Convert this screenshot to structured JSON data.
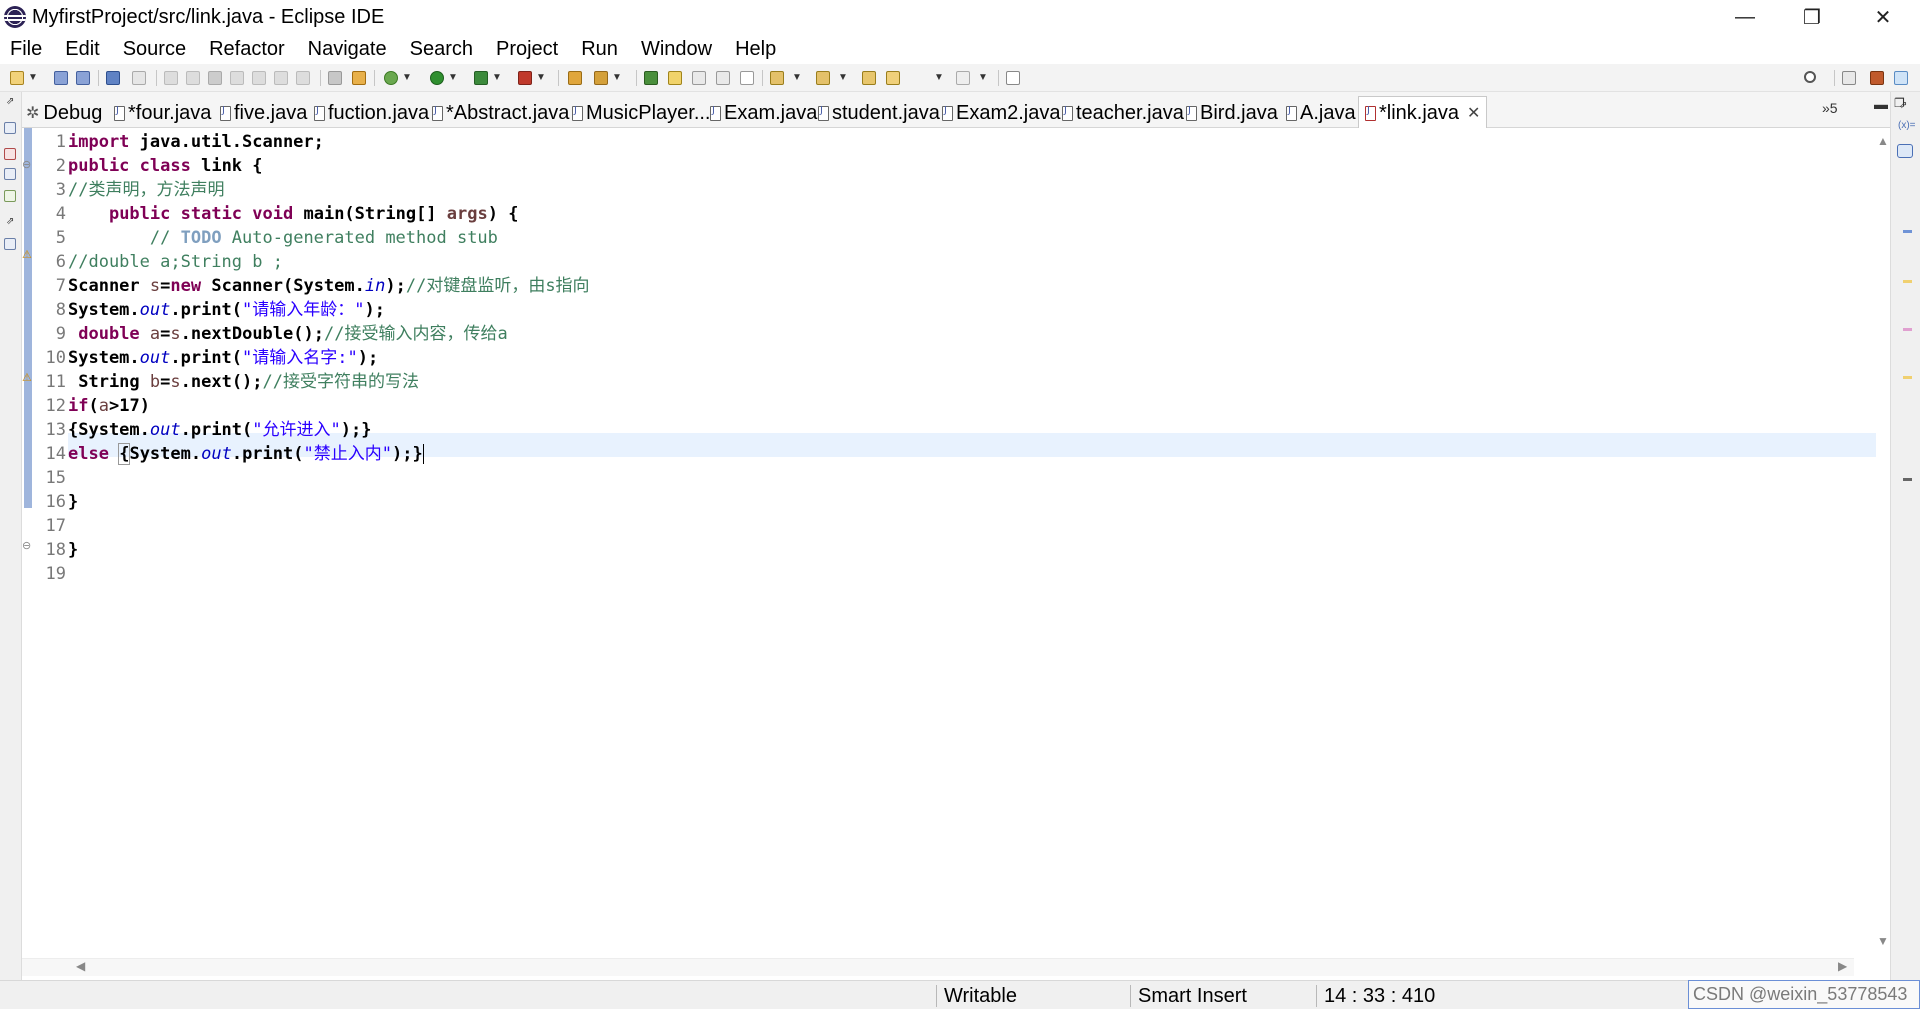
{
  "window": {
    "title": "MyfirstProject/src/link.java - Eclipse IDE",
    "minimize": "—",
    "maximize": "❐",
    "close": "✕"
  },
  "menu": [
    "File",
    "Edit",
    "Source",
    "Refactor",
    "Navigate",
    "Search",
    "Project",
    "Run",
    "Window",
    "Help"
  ],
  "tabs": [
    {
      "label": "Debug",
      "icon": "debug-icon"
    },
    {
      "label": "*four.java",
      "icon": "java-file-icon"
    },
    {
      "label": "five.java",
      "icon": "java-file-icon"
    },
    {
      "label": "fuction.java",
      "icon": "java-file-icon"
    },
    {
      "label": "*Abstract.java",
      "icon": "java-file-icon"
    },
    {
      "label": "MusicPlayer...",
      "icon": "java-file-icon"
    },
    {
      "label": "Exam.java",
      "icon": "java-file-icon"
    },
    {
      "label": "student.java",
      "icon": "java-file-icon"
    },
    {
      "label": "Exam2.java",
      "icon": "java-file-icon"
    },
    {
      "label": "teacher.java",
      "icon": "java-file-icon"
    },
    {
      "label": "Bird.java",
      "icon": "java-file-icon"
    },
    {
      "label": "A.java",
      "icon": "java-file-icon"
    },
    {
      "label": "*link.java",
      "icon": "java-file-error-icon",
      "active": true
    }
  ],
  "tab_overflow": "»5",
  "editor": {
    "line_numbers": [
      "1",
      "2",
      "3",
      "4",
      "5",
      "6",
      "7",
      "8",
      "9",
      "10",
      "11",
      "12",
      "13",
      "14",
      "15",
      "16",
      "17",
      "18",
      "19"
    ],
    "current_line": 14,
    "code": {
      "l1_kw": "import",
      "l1_rest": " java.util.Scanner;",
      "l2_kw1": "public",
      "l2_kw2": "class",
      "l2_rest": " link {",
      "l3_cmt": "//类声明，方法声明",
      "l4_indent": "    ",
      "l4_kw1": "public",
      "l4_kw2": "static",
      "l4_kw3": "void",
      "l4_rest": " main(String[] ",
      "l4_var": "args",
      "l4_end": ") {",
      "l5_indent": "        ",
      "l5_cmt1": "// ",
      "l5_todo": "TODO",
      "l5_cmt2": " Auto-generated method stub",
      "l6_cmt": "//double a;String b ;",
      "l7_a": "Scanner ",
      "l7_var": "s",
      "l7_b": "=",
      "l7_kw": "new",
      "l7_c": " Scanner(System.",
      "l7_fld": "in",
      "l7_d": ");",
      "l7_cmt": "//对键盘监听，由s指向",
      "l8_a": "System.",
      "l8_fld": "out",
      "l8_b": ".print(",
      "l8_str": "\"请输入年龄：\"",
      "l8_c": ");",
      "l9_a": " ",
      "l9_kw": "double",
      "l9_b": " ",
      "l9_var": "a",
      "l9_c": "=",
      "l9_var2": "s",
      "l9_d": ".nextDouble();",
      "l9_cmt": "//接受输入内容，传给a",
      "l10_a": "System.",
      "l10_fld": "out",
      "l10_b": ".print(",
      "l10_str": "\"请输入名字:\"",
      "l10_c": ");",
      "l11_a": " String ",
      "l11_var": "b",
      "l11_b": "=",
      "l11_var2": "s",
      "l11_c": ".next();",
      "l11_cmt": "//接受字符串的写法",
      "l12_kw": "if",
      "l12_a": "(",
      "l12_var": "a",
      "l12_b": ">17)",
      "l13_a": "{System.",
      "l13_fld": "out",
      "l13_b": ".print(",
      "l13_str": "\"允许进入\"",
      "l13_c": ");}",
      "l14_kw": "else",
      "l14_a": " ",
      "l14_br": "{",
      "l14_b": "System.",
      "l14_fld": "out",
      "l14_c": ".print(",
      "l14_str": "\"禁止入内\"",
      "l14_d": ");}",
      "l16": "}",
      "l18": "}"
    }
  },
  "status": {
    "writable": "Writable",
    "insert_mode": "Smart Insert",
    "position": "14 : 33 : 410"
  },
  "watermark": "CSDN @weixin_53778543",
  "colors": {
    "keyword": "#7f0055",
    "string": "#2a00ff",
    "comment": "#3f7f5f",
    "field": "#0000c0",
    "current_line": "#e8f2fe"
  }
}
